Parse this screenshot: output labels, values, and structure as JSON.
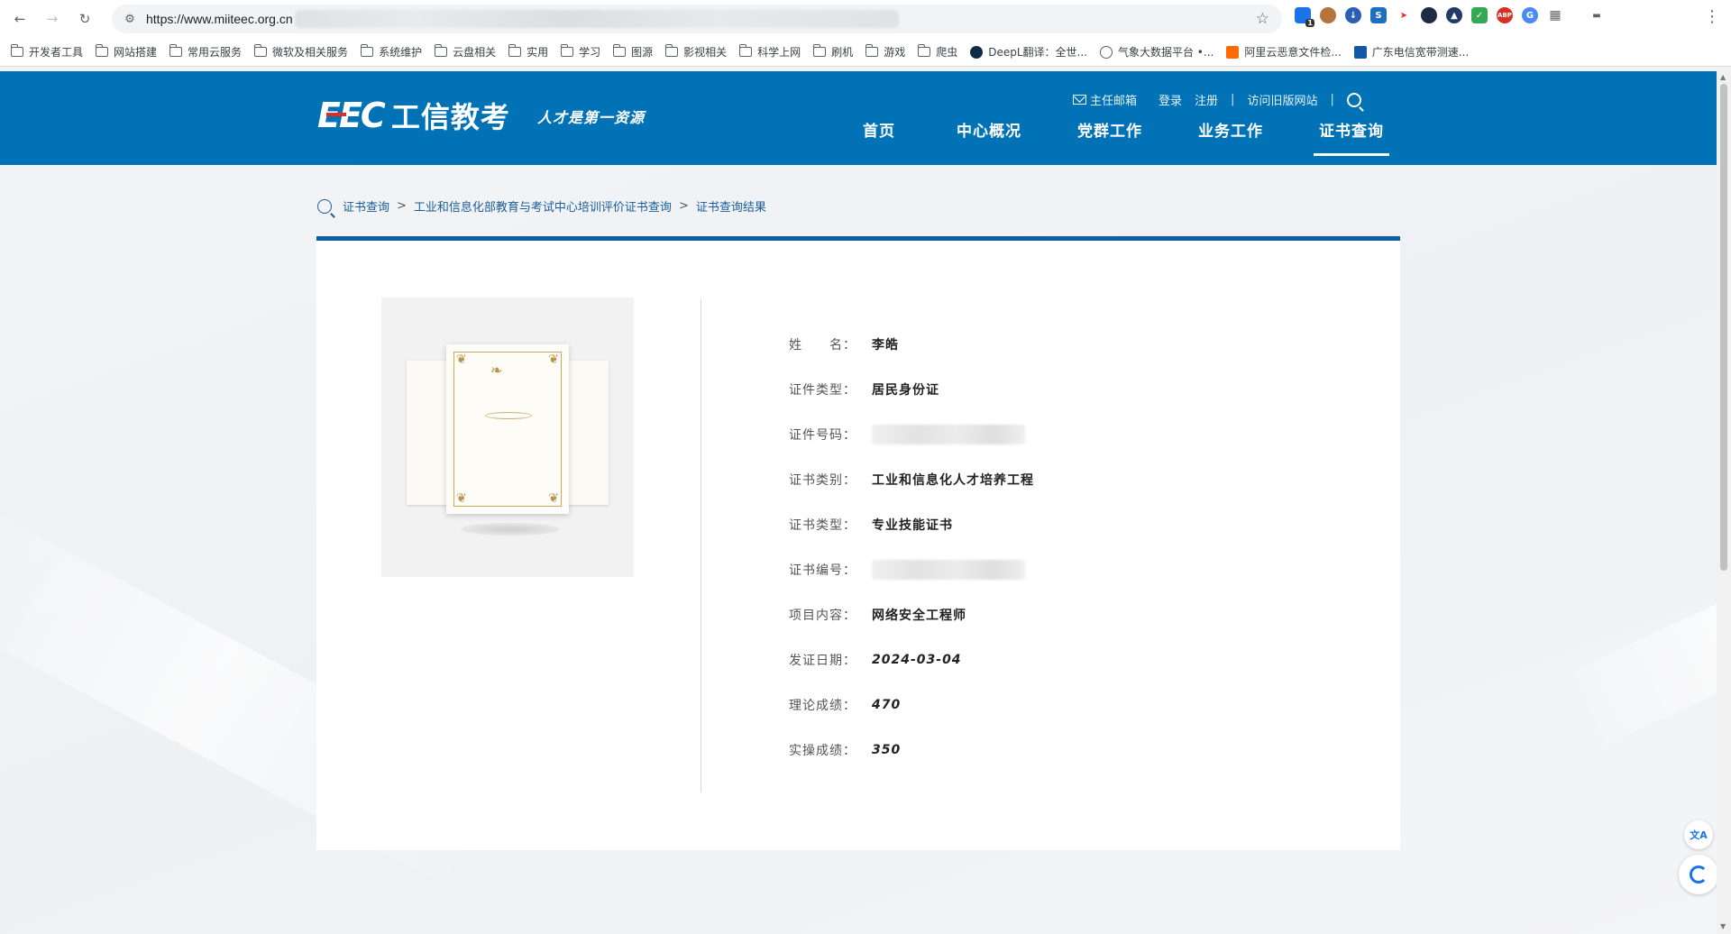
{
  "browser": {
    "url": "https://www.miiteec.org.cn",
    "bookmarks": [
      "开发者工具",
      "网站搭建",
      "常用云服务",
      "微软及相关服务",
      "系统维护",
      "云盘相关",
      "实用",
      "学习",
      "图源",
      "影视相关",
      "科学上网",
      "刷机",
      "游戏",
      "爬虫",
      "DeepL翻译：全世...",
      "气象大数据平台 •...",
      "阿里云恶意文件检...",
      "广东电信宽带测速..."
    ],
    "extension_badge": "1"
  },
  "header": {
    "logo_mark": "EEC",
    "logo_text": "工信教考",
    "slogan": "人才是第一资源",
    "top_links": {
      "mail": "主任邮箱",
      "login": "登录",
      "register": "注册",
      "old_site": "访问旧版网站"
    },
    "nav": [
      "首页",
      "中心概况",
      "党群工作",
      "业务工作",
      "证书查询"
    ],
    "active_nav": "证书查询"
  },
  "breadcrumb": [
    "证书查询",
    "工业和信息化部教育与考试中心培训评价证书查询",
    "证书查询结果"
  ],
  "certificate": {
    "fields": [
      {
        "label": "姓　　名：",
        "value": "李皓"
      },
      {
        "label": "证件类型：",
        "value": "居民身份证"
      },
      {
        "label": "证件号码：",
        "value": ""
      },
      {
        "label": "证书类别：",
        "value": "工业和信息化人才培养工程"
      },
      {
        "label": "证书类型：",
        "value": "专业技能证书"
      },
      {
        "label": "证书编号：",
        "value": ""
      },
      {
        "label": "项目内容：",
        "value": "网络安全工程师"
      },
      {
        "label": "发证日期：",
        "value": "2024-03-04"
      },
      {
        "label": "理论成绩：",
        "value": "470"
      },
      {
        "label": "实操成绩：",
        "value": "350"
      }
    ]
  },
  "floating": {
    "translate_icon": "文A"
  },
  "colors": {
    "header_blue": "#0072b5",
    "card_top_border": "#0e5ea6",
    "logo_red": "#e12b2b"
  }
}
